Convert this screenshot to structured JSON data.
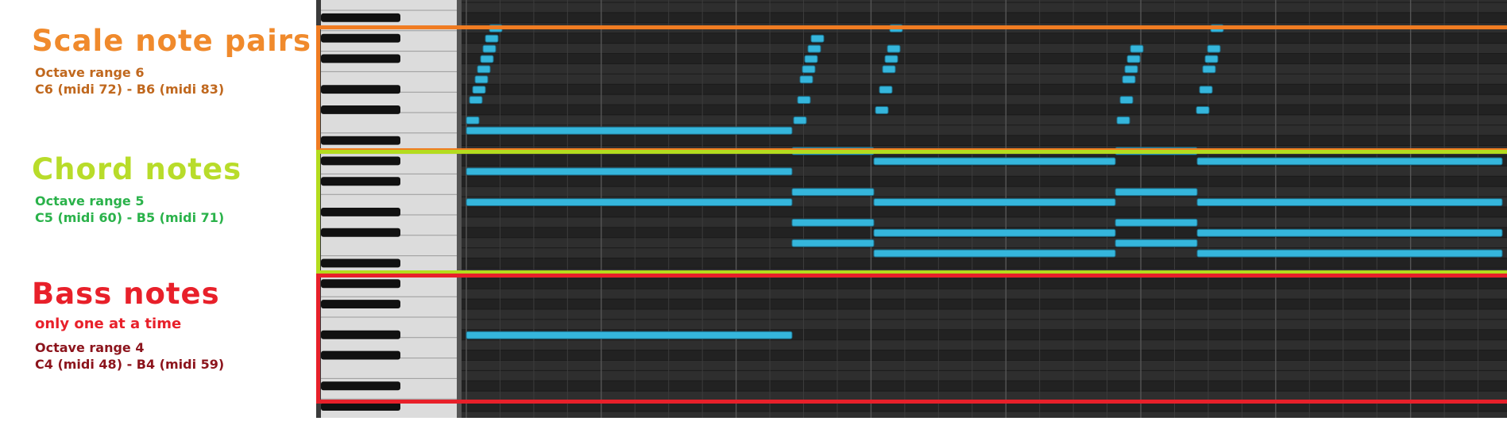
{
  "sections": {
    "scale": {
      "title": "Scale note pairs",
      "range": "Octave range 6",
      "midi": "C6 (midi 72) - B6 (midi 83)",
      "title_color": "#f08a2c",
      "text_color": "#c0681e",
      "frame_color": "#f07c22"
    },
    "chord": {
      "title": "Chord notes",
      "range": "Octave range 5",
      "midi": "C5 (midi 60) - B5 (midi 71)",
      "title_color": "#b8dc2a",
      "text_color": "#2ab24a",
      "frame_color": "#b4dc1e"
    },
    "bass": {
      "title": "Bass notes",
      "note": "only one at a time",
      "range": "Octave range 4",
      "midi": "C4 (midi 48) - B4 (midi 59)",
      "title_color": "#e8202a",
      "text_color": "#8c141c",
      "frame_color": "#e8202a"
    }
  },
  "note_color": "#35b6dc",
  "grid_colors": {
    "light_row": "#2e2e2e",
    "dark_row": "#222222",
    "line": "#3c3c3c",
    "bar_line": "#555555"
  }
}
